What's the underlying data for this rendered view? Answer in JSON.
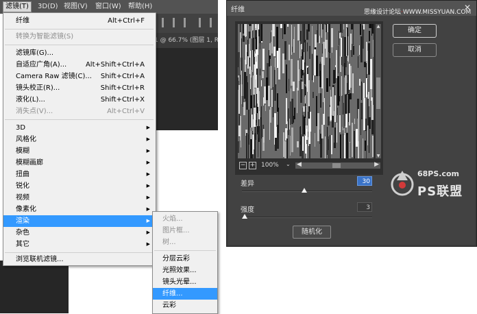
{
  "menubar": {
    "items": [
      "滤镜(T)",
      "3D(D)",
      "视图(V)",
      "窗口(W)",
      "帮助(H)"
    ]
  },
  "document_tab": "1 @ 66.7% (图层 1, R",
  "filter_menu": {
    "top": [
      {
        "label": "纤维",
        "shortcut": "Alt+Ctrl+F"
      }
    ],
    "convert": {
      "label": "转换为智能滤镜(S)"
    },
    "group2": [
      {
        "label": "滤镜库(G)...",
        "shortcut": ""
      },
      {
        "label": "自适应广角(A)...",
        "shortcut": "Alt+Shift+Ctrl+A"
      },
      {
        "label": "Camera Raw 滤镜(C)...",
        "shortcut": "Shift+Ctrl+A"
      },
      {
        "label": "镜头校正(R)...",
        "shortcut": "Shift+Ctrl+R"
      },
      {
        "label": "液化(L)...",
        "shortcut": "Shift+Ctrl+X"
      },
      {
        "label": "消失点(V)...",
        "shortcut": "Alt+Ctrl+V"
      }
    ],
    "submenus": [
      "3D",
      "风格化",
      "模糊",
      "模糊画廊",
      "扭曲",
      "锐化",
      "视频",
      "像素化",
      "渲染",
      "杂色",
      "其它"
    ],
    "browse": "浏览联机滤镜..."
  },
  "render_menu": {
    "disabled": [
      "火焰...",
      "图片框...",
      "树..."
    ],
    "enabled": [
      "分层云彩",
      "光照效果...",
      "镜头光晕...",
      "纤维...",
      "云彩"
    ]
  },
  "dialog": {
    "title": "纤维",
    "watermark_prefix": "思缘设计论坛",
    "watermark_site": "WWW.MISSYUAN.COM",
    "zoom": "100%",
    "ok": "确定",
    "cancel": "取消",
    "variance_label": "差异",
    "variance_value": "30",
    "variance_level": 0.48,
    "strength_label": "强度",
    "strength_value": "3",
    "strength_level": 0.02,
    "randomize": "随机化"
  },
  "logo": {
    "site": "68PS.com",
    "name": "PS联盟"
  },
  "colors": {
    "highlight": "#3399ff",
    "dialog_bg": "#424242",
    "menu_bg": "#f0f0f0"
  }
}
